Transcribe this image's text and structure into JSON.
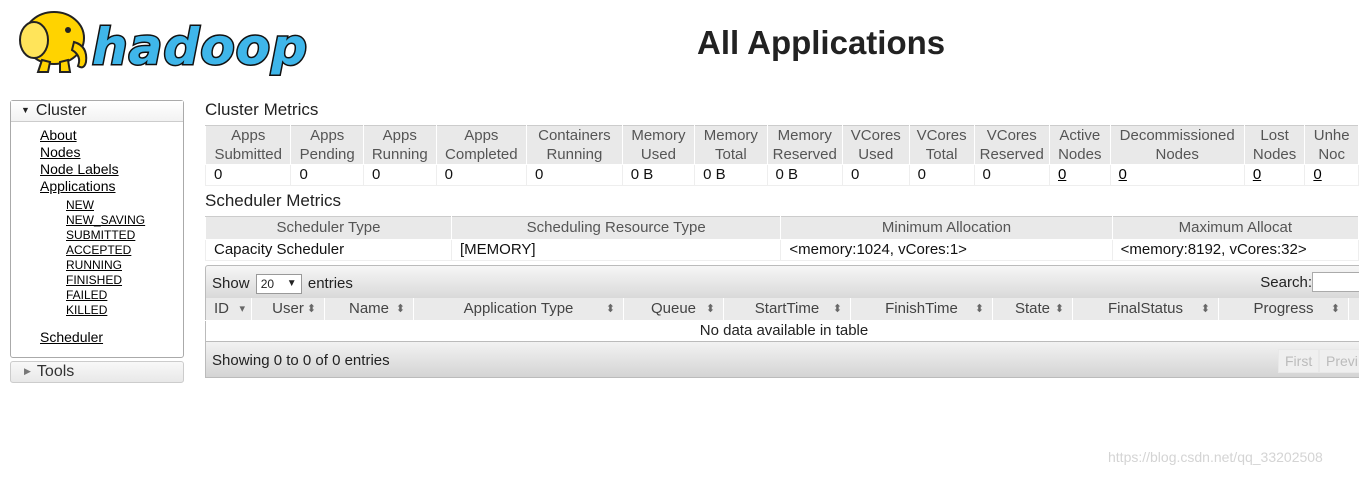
{
  "header": {
    "title": "All Applications",
    "logo_text": "hadoop"
  },
  "sidebar": {
    "cluster_label": "Cluster",
    "links": [
      {
        "label": "About"
      },
      {
        "label": "Nodes"
      },
      {
        "label": "Node Labels"
      },
      {
        "label": "Applications"
      }
    ],
    "app_states": [
      "NEW",
      "NEW_SAVING",
      "SUBMITTED",
      "ACCEPTED",
      "RUNNING",
      "FINISHED",
      "FAILED",
      "KILLED"
    ],
    "scheduler_label": "Scheduler",
    "tools_label": "Tools"
  },
  "cluster_metrics": {
    "title": "Cluster Metrics",
    "headers": [
      [
        "Apps",
        "Submitted"
      ],
      [
        "Apps",
        "Pending"
      ],
      [
        "Apps",
        "Running"
      ],
      [
        "Apps",
        "Completed"
      ],
      [
        "Containers",
        "Running"
      ],
      [
        "Memory",
        "Used"
      ],
      [
        "Memory",
        "Total"
      ],
      [
        "Memory",
        "Reserved"
      ],
      [
        "VCores",
        "Used"
      ],
      [
        "VCores",
        "Total"
      ],
      [
        "VCores",
        "Reserved"
      ],
      [
        "Active",
        "Nodes"
      ],
      [
        "Decommissioned",
        "Nodes"
      ],
      [
        "Lost",
        "Nodes"
      ],
      [
        "Unhe",
        "Noc"
      ]
    ],
    "values": [
      "0",
      "0",
      "0",
      "0",
      "0",
      "0 B",
      "0 B",
      "0 B",
      "0",
      "0",
      "0",
      "0",
      "0",
      "0",
      "0"
    ]
  },
  "scheduler_metrics": {
    "title": "Scheduler Metrics",
    "headers": [
      "Scheduler Type",
      "Scheduling Resource Type",
      "Minimum Allocation",
      "Maximum Allocat"
    ],
    "values": [
      "Capacity Scheduler",
      "[MEMORY]",
      "<memory:1024, vCores:1>",
      "<memory:8192, vCores:32>"
    ]
  },
  "apps_table": {
    "show_label": "Show",
    "page_length": "20",
    "entries_label": "entries",
    "search_label": "Search:",
    "search_value": "",
    "columns": [
      "ID",
      "User",
      "Name",
      "Application Type",
      "Queue",
      "StartTime",
      "FinishTime",
      "State",
      "FinalStatus",
      "Progress"
    ],
    "empty_message": "No data available in table",
    "info": "Showing 0 to 0 of 0 entries",
    "pagination": [
      "First",
      "Previ"
    ]
  },
  "watermark": "https://blog.csdn.net/qq_33202508",
  "colors": {
    "logo_blue": "#3fb6ea",
    "logo_yellow": "#ffd300",
    "header_gray": "#e9e9e9"
  }
}
